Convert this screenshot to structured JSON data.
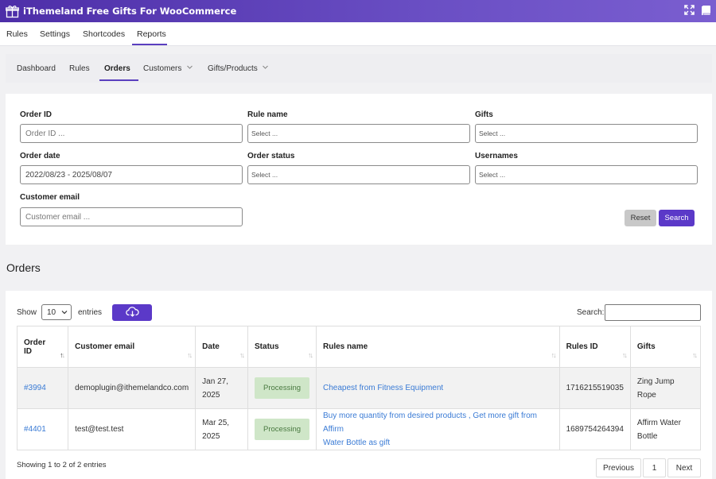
{
  "app": {
    "title": "iThemeland Free Gifts For WooCommerce",
    "logo_icon": "gift-box-icon",
    "header_icons": [
      "fullscreen-icon",
      "book-icon"
    ],
    "brand_color": "#5b39c8"
  },
  "main_nav": {
    "items": [
      "Rules",
      "Settings",
      "Shortcodes",
      "Reports"
    ],
    "active": "Reports"
  },
  "sub_nav": {
    "items": [
      "Dashboard",
      "Rules",
      "Orders",
      "Customers",
      "Gifts/Products"
    ],
    "active": "Orders",
    "dropdown_items": [
      "Customers",
      "Gifts/Products"
    ]
  },
  "filters": {
    "order_id": {
      "label": "Order ID",
      "placeholder": "Order ID ..."
    },
    "rule_name": {
      "label": "Rule name",
      "placeholder": "Select ..."
    },
    "gifts": {
      "label": "Gifts",
      "placeholder": "Select ..."
    },
    "order_date": {
      "label": "Order date",
      "value": "2022/08/23 - 2025/08/07"
    },
    "order_status": {
      "label": "Order status",
      "placeholder": "Select ..."
    },
    "usernames": {
      "label": "Usernames",
      "placeholder": "Select ..."
    },
    "customer_email": {
      "label": "Customer email",
      "placeholder": "Customer email ..."
    },
    "reset_label": "Reset",
    "search_label": "Search"
  },
  "orders_section": {
    "title": "Orders",
    "show_label": "Show",
    "page_length": "10",
    "entries_label": "entries",
    "export_icon": "cloud-download-icon",
    "search_label": "Search:",
    "columns": [
      {
        "line1": "Order",
        "line2": "ID"
      },
      {
        "line1": "Customer email",
        "line2": ""
      },
      {
        "line1": "Date",
        "line2": ""
      },
      {
        "line1": "Status",
        "line2": ""
      },
      {
        "line1": "Rules name",
        "line2": ""
      },
      {
        "line1": "Rules ID",
        "line2": ""
      },
      {
        "line1": "Gifts",
        "line2": ""
      }
    ],
    "rows": [
      {
        "order_id": "#3994",
        "customer_email": "demoplugin@ithemelandco.com",
        "date_1": "Jan 27,",
        "date_2": "2025",
        "status": "Processing",
        "rules_name_1": "Cheapest from Fitness Equipment",
        "rules_name_2": "",
        "rules_id": "1716215519035",
        "gifts_1": "Zing Jump Rope",
        "gifts_2": ""
      },
      {
        "order_id": "#4401",
        "customer_email": "test@test.test",
        "date_1": "Mar 25,",
        "date_2": "2025",
        "status": "Processing",
        "rules_name_1": "Buy more quantity from desired products , Get more gift from Affirm",
        "rules_name_2": "Water Bottle as gift",
        "rules_id": "1689754264394",
        "gifts_1": "Affirm Water",
        "gifts_2": "Bottle"
      }
    ],
    "info": "Showing 1 to 2 of 2 entries",
    "pagination": {
      "previous": "Previous",
      "page": "1",
      "next": "Next"
    }
  }
}
